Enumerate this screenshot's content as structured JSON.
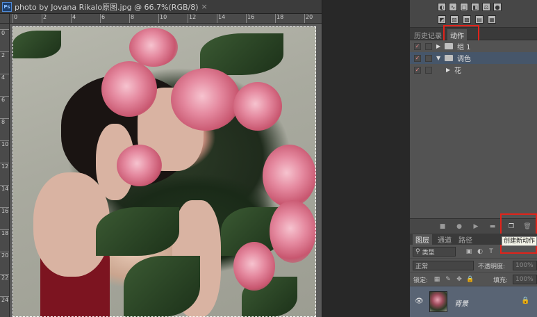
{
  "document": {
    "app_badge": "Ps",
    "title": "photo by Jovana Rikalo原图.jpg @ 66.7%(RGB/8)",
    "close_glyph": "×",
    "ruler_h_ticks": [
      "0",
      "2",
      "4",
      "6",
      "8",
      "10",
      "12",
      "14",
      "16",
      "18",
      "20"
    ],
    "ruler_v_ticks": [
      "0",
      "2",
      "4",
      "6",
      "8",
      "10",
      "12",
      "14",
      "16",
      "18",
      "20",
      "22",
      "24"
    ]
  },
  "panel_tabs": {
    "history": "历史记录",
    "actions": "动作"
  },
  "actions": {
    "rows": [
      {
        "label": "组 1",
        "expanded": false,
        "type": "set"
      },
      {
        "label": "调色",
        "expanded": true,
        "type": "set",
        "selected": true
      },
      {
        "label": "花",
        "expanded": false,
        "type": "action"
      }
    ],
    "bar_icons": [
      "stop-icon",
      "record-icon",
      "play-icon",
      "new-set-icon",
      "new-action-icon",
      "delete-icon"
    ]
  },
  "tooltip": "创建新动作",
  "layers": {
    "tabs": [
      "图层",
      "通道",
      "路径"
    ],
    "filter_label": "类型",
    "blend_mode": "正常",
    "opacity_label": "不透明度:",
    "opacity_value": "100%",
    "lock_label": "锁定:",
    "fill_label": "填充:",
    "fill_value": "100%",
    "layer_name": "背景"
  },
  "colors": {
    "highlight_red": "#e2231a",
    "selected_row": "#46566a",
    "panel_bg": "#535353"
  }
}
